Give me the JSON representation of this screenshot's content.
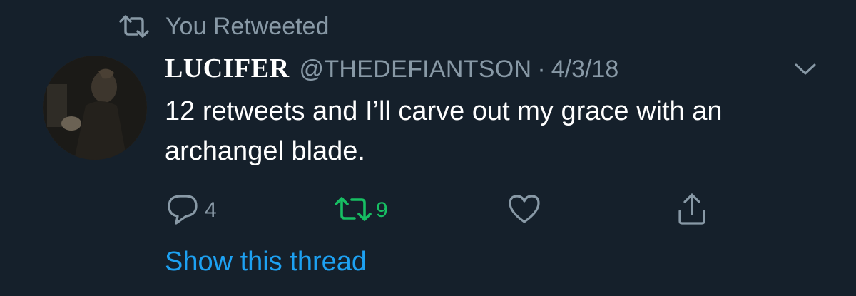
{
  "retweet_context": {
    "label": "You Retweeted",
    "icon": "retweet-icon"
  },
  "tweet": {
    "display_name": "LUCIFER",
    "handle": "@THEDEFIANTSON",
    "separator": "·",
    "date": "4/3/18",
    "text": "12 retweets and I’ll carve out my grace with an archangel blade.",
    "menu_icon": "chevron-down-icon"
  },
  "actions": {
    "reply": {
      "icon": "reply-icon",
      "count": "4"
    },
    "retweet": {
      "icon": "retweet-icon",
      "count": "9",
      "active_color": "#17bf63"
    },
    "like": {
      "icon": "heart-icon",
      "count": ""
    },
    "share": {
      "icon": "share-icon"
    }
  },
  "show_thread_label": "Show this thread",
  "colors": {
    "background": "#15202b",
    "muted": "#8899a6",
    "link": "#1da1f2",
    "retweet_active": "#17bf63"
  }
}
